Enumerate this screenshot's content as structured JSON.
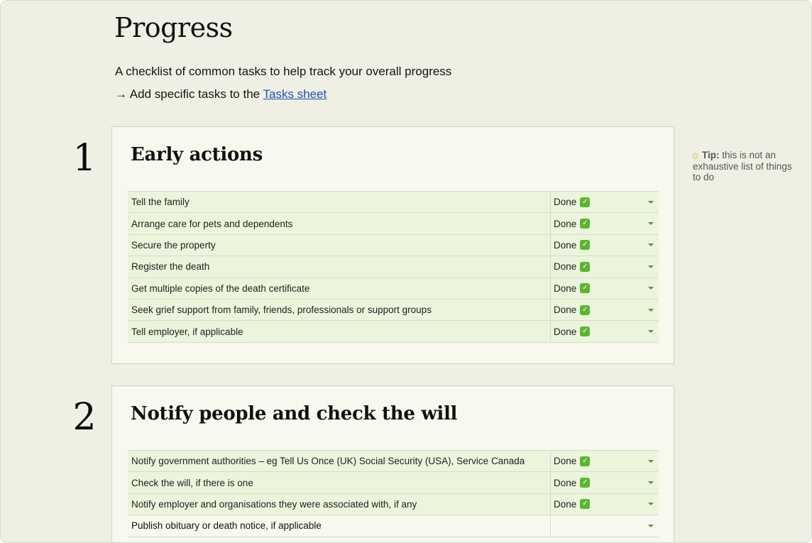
{
  "page": {
    "title": "Progress",
    "subtitle": "A checklist of common tasks to help track your overall progress",
    "tasks_link_prefix": "→ Add specific tasks to the ",
    "tasks_link_label": "Tasks sheet"
  },
  "tip": {
    "bold": "Tip:",
    "text": " this is not an exhaustive list of things to do"
  },
  "colors": {
    "background": "#efefe4",
    "card": "#f8f8ef",
    "done_row": "#eaf5dc",
    "link": "#1f4fb5",
    "check": "#5bb531"
  },
  "sections": [
    {
      "number": "1",
      "title": "Early actions",
      "tasks": [
        {
          "name": "Tell the family",
          "status": "Done",
          "done": true
        },
        {
          "name": "Arrange care for pets and dependents",
          "status": "Done",
          "done": true
        },
        {
          "name": "Secure the property",
          "status": "Done",
          "done": true
        },
        {
          "name": "Register the death",
          "status": "Done",
          "done": true
        },
        {
          "name": "Get multiple copies of the death certificate",
          "status": "Done",
          "done": true
        },
        {
          "name": "Seek grief support from family, friends, professionals or support groups",
          "status": "Done",
          "done": true
        },
        {
          "name": "Tell employer, if applicable",
          "status": "Done",
          "done": true
        }
      ]
    },
    {
      "number": "2",
      "title": "Notify people and check the will",
      "tasks": [
        {
          "name": "Notify government authorities – eg Tell Us Once (UK) Social Security (USA), Service Canada",
          "status": "Done",
          "done": true
        },
        {
          "name": "Check the will, if there is one",
          "status": "Done",
          "done": true
        },
        {
          "name": "Notify employer and organisations they were associated with, if any",
          "status": "Done",
          "done": true
        },
        {
          "name": "Publish obituary or death notice, if applicable",
          "status": "",
          "done": false
        }
      ]
    }
  ]
}
